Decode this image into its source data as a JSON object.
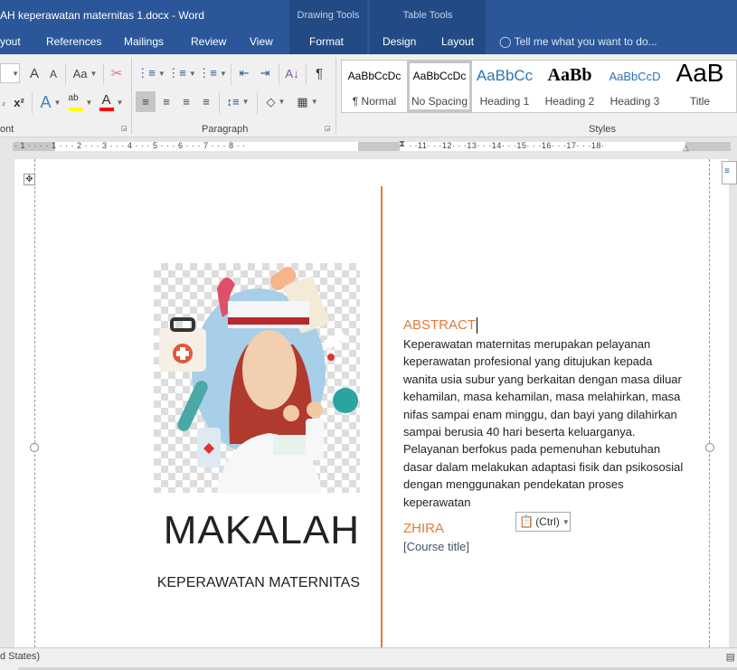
{
  "titlebar": {
    "document_title": "AH keperawatan maternitas 1.docx - Word",
    "context_groups": {
      "drawing_tools": "Drawing Tools",
      "table_tools": "Table Tools"
    }
  },
  "tabs": [
    {
      "label": "yout"
    },
    {
      "label": "References"
    },
    {
      "label": "Mailings"
    },
    {
      "label": "Review"
    },
    {
      "label": "View"
    },
    {
      "label": "Format"
    },
    {
      "label": "Design"
    },
    {
      "label": "Layout"
    }
  ],
  "tell_me": {
    "placeholder": "Tell me what you want to do..."
  },
  "ribbon": {
    "font_group_label": "ont",
    "paragraph_group_label": "Paragraph",
    "styles_group_label": "Styles",
    "font_buttons": {
      "grow": "A",
      "shrink": "A",
      "change_case": "Aa",
      "superscript": "x²",
      "subscript": "₂"
    },
    "highlight_color": "#ffff00",
    "font_color": "#ff0000",
    "pilcrow": "¶",
    "styles": [
      {
        "preview": "AaBbCcDc",
        "name": "¶ Normal"
      },
      {
        "preview": "AaBbCcDc",
        "name": "No Spacing",
        "selected": true
      },
      {
        "preview": "AaBbCc",
        "name": "Heading 1"
      },
      {
        "preview": "AaBb",
        "name": "Heading 2"
      },
      {
        "preview": "AaBbCcD",
        "name": "Heading 3"
      },
      {
        "preview": "AaB",
        "name": "Title"
      }
    ]
  },
  "ruler": {
    "left_numbers": "· 1 ·   · · · 1 · · · 2 · · · 3 · · · 4 · · · 5 · · · 6 · · · 7 · · · 8 · ·",
    "right_numbers": "· ·11· · ·12· · ·13· · ·14· · ·15· · ·16· · ·17· · ·18·"
  },
  "document": {
    "image_alt": "nurse illustration",
    "title": "MAKALAH",
    "subtitle": "KEPERAWATAN MATERNITAS",
    "abstract_heading": "ABSTRACT",
    "abstract_body": "Keperawatan maternitas merupakan pelayanan keperawatan profesional yang ditujukan kepada wanita usia subur yang berkaitan dengan masa diluar kehamilan, masa kehamilan, masa melahirkan, masa nifas sampai enam minggu, dan bayi yang dilahirkan sampai berusia 40 hari beserta keluarganya. Pelayanan berfokus pada pemenuhan kebutuhan dasar dalam melakukan adaptasi fisik dan psikososial dengan menggunakan pendekatan proses keperawatan",
    "author": "ZHIRA",
    "course_title": "[Course title]",
    "paste_options": "(Ctrl)",
    "accent_color": "#e07b39"
  },
  "statusbar": {
    "language": "d States)"
  }
}
